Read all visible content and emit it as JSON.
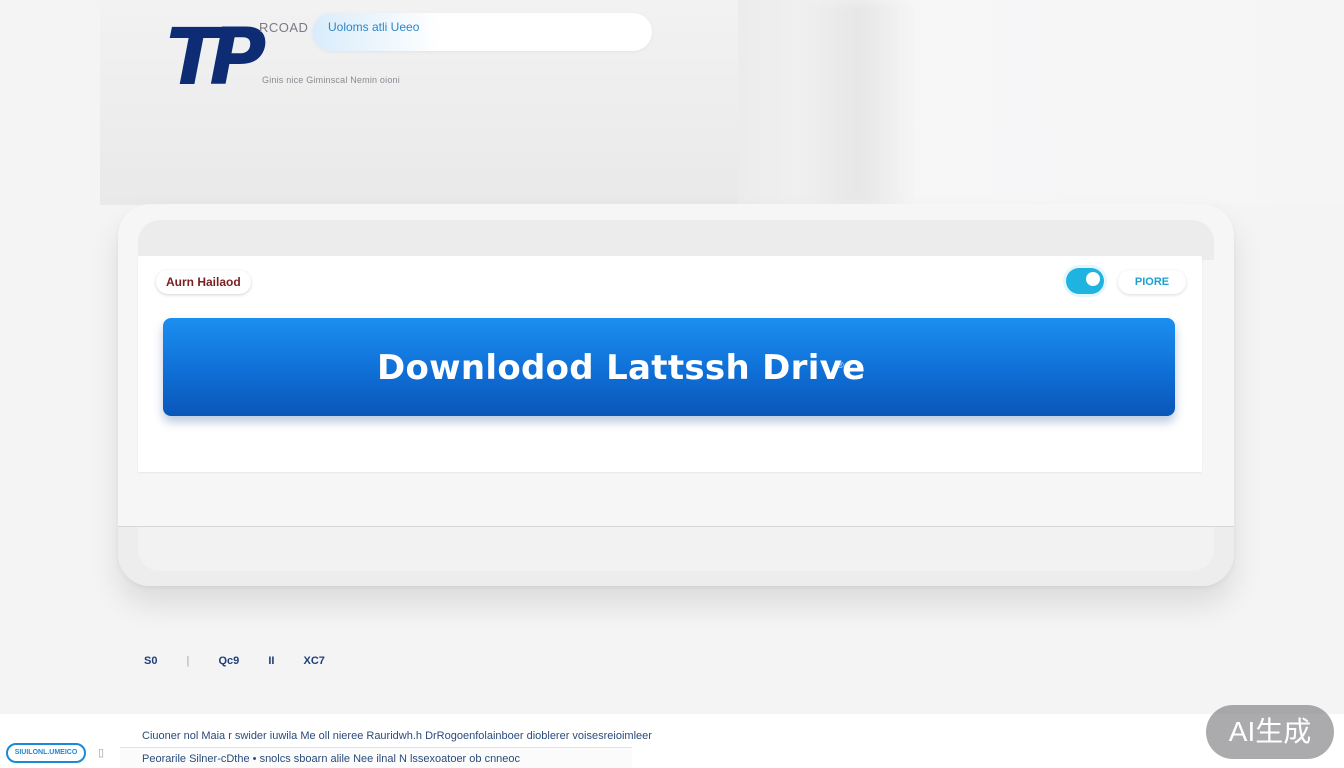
{
  "header": {
    "logo_text": "TP",
    "brand_word": "RCOAD",
    "search_pill_label": "Uoloms atli Ueeo",
    "subtitle": "Ginis nice  Giminscal Nemin oioni"
  },
  "card": {
    "tag_left": "Aurn Hailaod",
    "pill_right": "PIORE",
    "download_button_label": "Downlodod Lattssh Drive",
    "download_button_mark": "®"
  },
  "stats": {
    "items": [
      "S0",
      "Qc9",
      "II",
      "XC7"
    ]
  },
  "footer": {
    "pill_label": "SIUILONL.UMEICO",
    "line1": "Ciuoner nol Maia r swider iuwila Me oll nieree  Rauridwh.h DrRogoenfolainboer dioblerer voisesreioimleer",
    "line2": "Peorarile  Silner-cDthe  • snolcs   sboarn alile  Nee   ilnal  N lssexoatoer ob cnneoc"
  },
  "badge": {
    "label": "AI生成"
  },
  "colors": {
    "brand_navy": "#0e2c73",
    "button_blue": "#0f6fd6",
    "accent_cyan": "#1fb3e0",
    "tag_maroon": "#7a1f1f"
  }
}
